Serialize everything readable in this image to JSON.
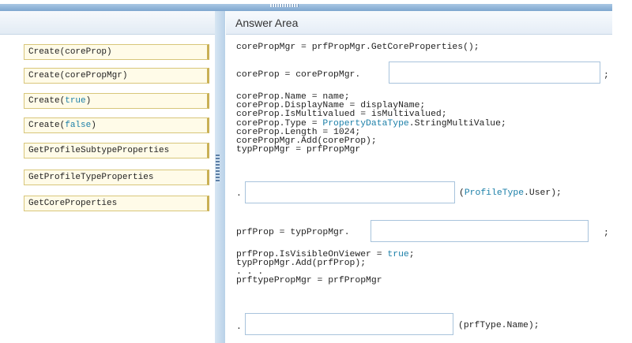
{
  "answer_area": {
    "title": "Answer Area"
  },
  "options": [
    {
      "pre": "Create(",
      "arg": "coreProp",
      "post": ")",
      "arg_kw": false
    },
    {
      "pre": "Create(",
      "arg": "corePropMgr",
      "post": ")",
      "arg_kw": false
    },
    {
      "pre": "Create(",
      "arg": "true",
      "post": ")",
      "arg_kw": true
    },
    {
      "pre": "Create(",
      "arg": "false",
      "post": ")",
      "arg_kw": true
    },
    {
      "pre": "GetProfileSubtypeProperties",
      "arg": "",
      "post": "",
      "arg_kw": false
    },
    {
      "pre": "GetProfileTypeProperties",
      "arg": "",
      "post": "",
      "arg_kw": false
    },
    {
      "pre": "GetCoreProperties",
      "arg": "",
      "post": "",
      "arg_kw": false
    }
  ],
  "code": {
    "line1": "corePropMgr = prfPropMgr.GetCoreProperties();",
    "line2_prefix": "coreProp = corePropMgr.",
    "line2_suffix": ";",
    "block1": [
      "coreProp.Name = name;",
      "coreProp.DisplayName = displayName;",
      "coreProp.IsMultivalued = isMultivalued;"
    ],
    "type_line": {
      "pre": "coreProp.Type = ",
      "kw": "PropertyDataType",
      "post": ".StringMultiValue;"
    },
    "block2": [
      "coreProp.Length = 1024;",
      "corePropMgr.Add(coreProp);",
      "typPropMgr = prfPropMgr"
    ],
    "slot3_prefix": ".",
    "slot3_suffix": {
      "open": "(",
      "kw": "ProfileType",
      "post": ".User);"
    },
    "line_prf_prefix": "prfProp = typPropMgr.",
    "line_prf_suffix": ";",
    "visible_line": {
      "pre": "prfProp.IsVisibleOnViewer = ",
      "kw": "true",
      "post": ";"
    },
    "block3": [
      "typPropMgr.Add(prfProp);",
      ". . .",
      "prftypePropMgr = prfPropMgr"
    ],
    "slot5_prefix": ".",
    "slot5_suffix": "(prfType.Name);"
  }
}
